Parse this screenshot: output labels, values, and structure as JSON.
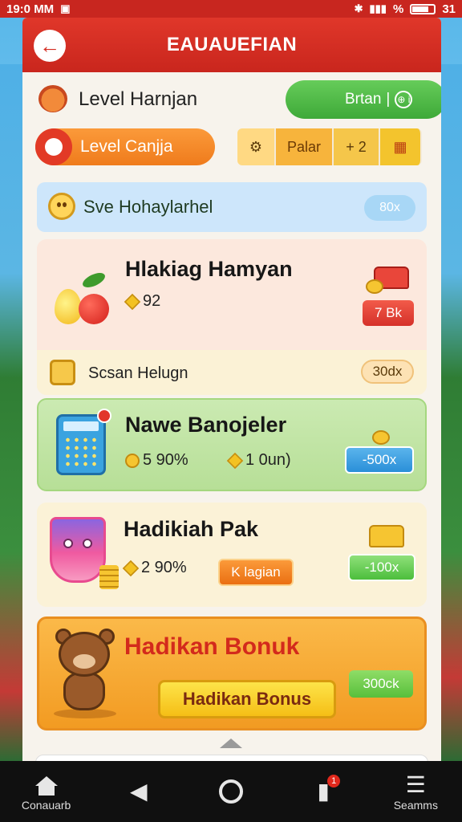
{
  "status_bar": {
    "time": "19:0 MM",
    "battery_text": "%",
    "right_text": "31"
  },
  "header": {
    "title": "EAUAUEFIAN"
  },
  "level": {
    "title": "Level Harnjan",
    "pill_label": "Brtan",
    "pill_icon_text": "⊕ i"
  },
  "controls": {
    "orange_button": "Level Canjja",
    "tab_label": "Palar",
    "tab_count": "+ 2"
  },
  "info": {
    "text": "Sve Hohaylarhel",
    "badge": "80x"
  },
  "cards": [
    {
      "title": "Hlakiag Hamyan",
      "sub": "92",
      "badge": "7 Bk",
      "row_text": "Scsan Helugn",
      "row_badge": "30dx"
    },
    {
      "title": "Nawe Banojeler",
      "sub1": "5 90%",
      "sub2": "1 0un)",
      "badge": "-500x"
    },
    {
      "title": "Hadikiah Pak",
      "sub": "2 90%",
      "button": "K lagian",
      "badge": "-100x"
    }
  ],
  "bonus": {
    "title": "Hadikan Bonuk",
    "button": "Hadikan Bonus",
    "badge": "300ck"
  },
  "nav": {
    "left_label": "Conauarb",
    "right_label": "Seamms",
    "notif_count": "1"
  },
  "colors": {
    "header": "#c9261d",
    "accent_orange": "#ef7b1c",
    "accent_green": "#3ea938",
    "bonus_red": "#d32a1c"
  },
  "icons": [
    "back-arrow-icon",
    "shield-icon",
    "settings-icon",
    "coin-icon",
    "gem-icon",
    "home-icon",
    "back-triangle-icon",
    "circle-home-icon",
    "bookmark-icon",
    "menu-icon"
  ]
}
